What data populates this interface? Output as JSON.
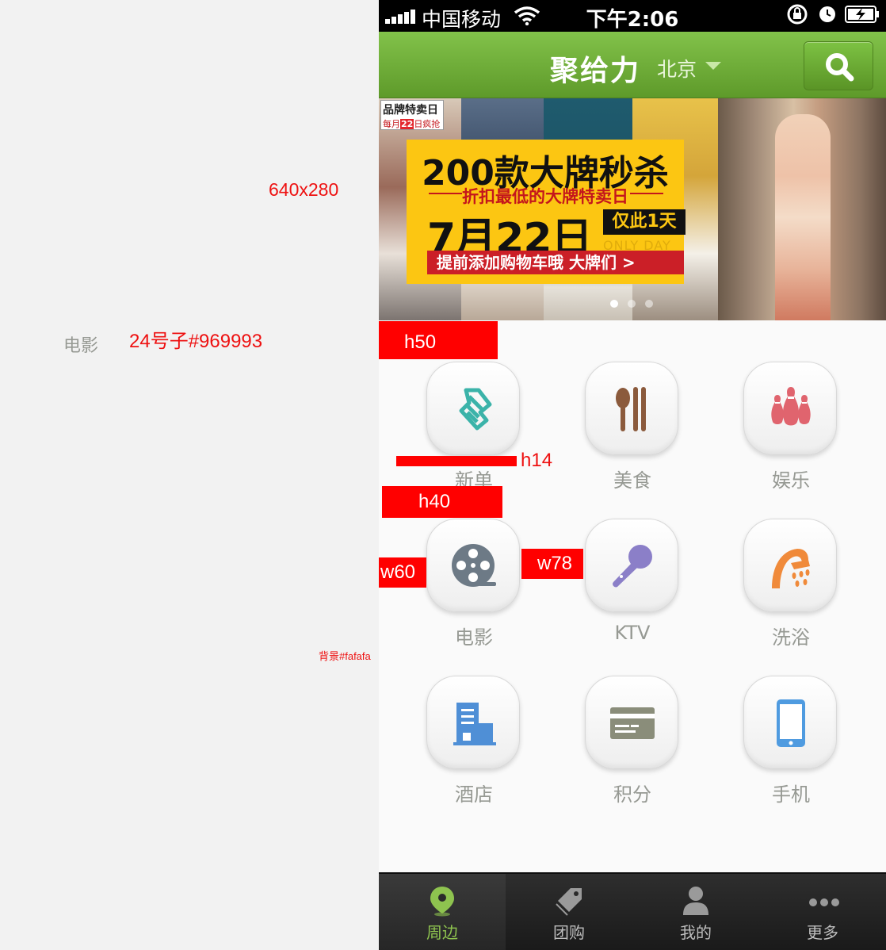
{
  "annotations": {
    "banner_size": "640x280",
    "sample_label": "电影",
    "font_spec": "24号子#969993",
    "background_spec": "背景#fafafa"
  },
  "statusbar": {
    "carrier": "中国移动",
    "time": "下午2:06"
  },
  "navbar": {
    "title": "聚给力",
    "city": "北京"
  },
  "banner": {
    "tag_top": "品牌特卖日",
    "tag_bottom_pre": "每月",
    "tag_bottom_day": "22",
    "tag_bottom_post": "日疯抢",
    "headline": "200款大牌秒杀",
    "subheadline": "折扣最低的大牌特卖日",
    "date": "7月22日",
    "only": "仅此1天",
    "only_en": "ONLY DAY",
    "cta": "提前添加购物车哦  大牌们 >",
    "page_count": 3,
    "active_page": 1
  },
  "grid": [
    {
      "label": "新单",
      "icon": "scroll-icon",
      "color": "#3bb3a9"
    },
    {
      "label": "美食",
      "icon": "spoon-chopsticks-icon",
      "color": "#8b5a3c"
    },
    {
      "label": "娱乐",
      "icon": "bowling-icon",
      "color": "#e0646e"
    },
    {
      "label": "电影",
      "icon": "film-reel-icon",
      "color": "#6d7a86"
    },
    {
      "label": "KTV",
      "icon": "microphone-icon",
      "color": "#8b7fc8"
    },
    {
      "label": "洗浴",
      "icon": "shower-icon",
      "color": "#f08a3a"
    },
    {
      "label": "酒店",
      "icon": "building-icon",
      "color": "#4f8fd6"
    },
    {
      "label": "积分",
      "icon": "card-icon",
      "color": "#8a8d7a"
    },
    {
      "label": "手机",
      "icon": "phone-icon",
      "color": "#4f9be0"
    }
  ],
  "measure_marks": {
    "h50": "h50",
    "h14": "h14",
    "h40": "h40",
    "w60": "w60",
    "w78": "w78"
  },
  "tabbar": [
    {
      "label": "周边",
      "icon": "location-pin-icon",
      "active": true
    },
    {
      "label": "团购",
      "icon": "tag-icon",
      "active": false
    },
    {
      "label": "我的",
      "icon": "user-icon",
      "active": false
    },
    {
      "label": "更多",
      "icon": "more-dots-icon",
      "active": false
    }
  ],
  "colors": {
    "label_gray": "#969993",
    "page_bg": "#fafafa",
    "nav_green": "#6aab35",
    "tab_active": "#8ec34f",
    "mark_red": "#ff0000"
  }
}
